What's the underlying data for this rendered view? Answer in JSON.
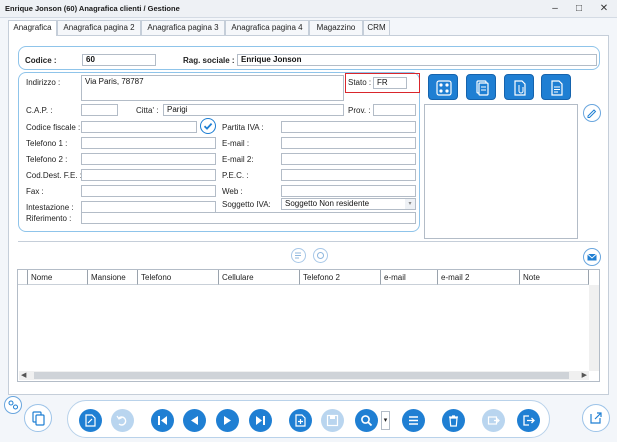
{
  "window": {
    "title": "Enrique Jonson (60) Anagrafica clienti / Gestione",
    "minimize": "–",
    "maximize": "□",
    "close": "✕"
  },
  "tabs": [
    {
      "label": "Anagrafica",
      "active": true
    },
    {
      "label": "Anagrafica pagina 2"
    },
    {
      "label": "Anagrafica pagina 3"
    },
    {
      "label": "Anagrafica pagina 4"
    },
    {
      "label": "Magazzino"
    },
    {
      "label": "CRM"
    }
  ],
  "header": {
    "codice_label": "Codice :",
    "codice_value": "60",
    "ragsoc_label": "Rag. sociale :",
    "ragsoc_value": "Enrique Jonson"
  },
  "form": {
    "indirizzo_label": "Indirizzo :",
    "indirizzo_value": "Via Paris, 78787",
    "stato_label": "Stato :",
    "stato_value": "FR",
    "cap_label": "C.A.P. :",
    "cap_value": "",
    "citta_label": "Citta' :",
    "citta_value": "Parigi",
    "prov_label": "Prov. :",
    "prov_value": "",
    "cf_label": "Codice fiscale :",
    "cf_value": "",
    "piva_label": "Partita IVA :",
    "piva_value": "",
    "tel1_label": "Telefono 1 :",
    "tel1_value": "",
    "email_label": "E-mail :",
    "email_value": "",
    "tel2_label": "Telefono 2 :",
    "tel2_value": "",
    "email2_label": "E-mail 2:",
    "email2_value": "",
    "codfe_label": "Cod.Dest. F.E. :",
    "codfe_value": "",
    "pec_label": "P.E.C. :",
    "pec_value": "",
    "fax_label": "Fax :",
    "fax_value": "",
    "web_label": "Web :",
    "web_value": "",
    "intest_label": "Intestazione :",
    "intest_value": "",
    "sogg_label": "Soggetto IVA:",
    "sogg_value": "Soggetto Non residente",
    "rif_label": "Riferimento :",
    "rif_value": ""
  },
  "contacts_table": {
    "columns": [
      "Nome",
      "Mansione",
      "Telefono",
      "Cellulare",
      "Telefono 2",
      "e-mail",
      "e-mail 2",
      "Note"
    ],
    "rows": []
  },
  "colors": {
    "accent": "#1f7fd3",
    "accent_disabled": "#b9d5ef",
    "frame": "#8fc4ea",
    "highlight": "#d9262c"
  }
}
